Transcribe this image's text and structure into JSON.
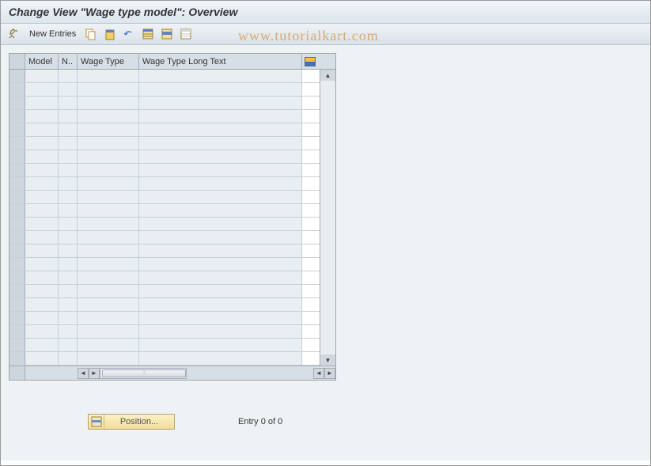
{
  "title": "Change View \"Wage type model\": Overview",
  "toolbar": {
    "new_entries_label": "New Entries"
  },
  "watermark": "www.tutorialkart.com",
  "table": {
    "columns": {
      "model": "Model",
      "n": "N..",
      "wage_type": "Wage Type",
      "wage_long": "Wage Type Long Text"
    },
    "row_count": 22
  },
  "footer": {
    "position_label": "Position...",
    "entry_text": "Entry 0 of 0"
  }
}
